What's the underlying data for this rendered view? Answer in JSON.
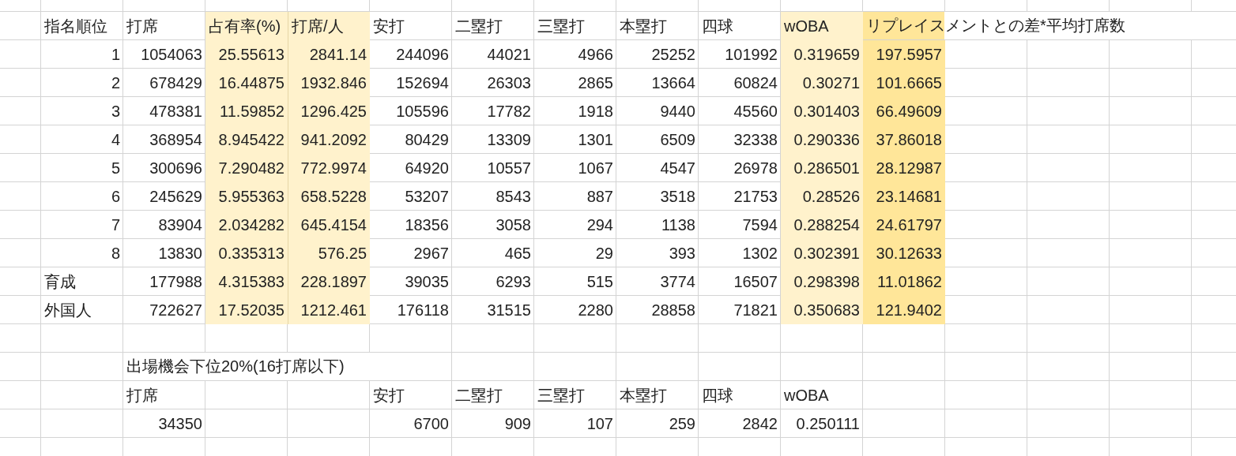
{
  "table": {
    "columns": [
      {
        "label": "指名順位"
      },
      {
        "label": "打席"
      },
      {
        "label": "占有率(%)",
        "color": "#fff2cc"
      },
      {
        "label": "打席/人",
        "color": "#fff2cc"
      },
      {
        "label": "安打"
      },
      {
        "label": "二塁打"
      },
      {
        "label": "三塁打"
      },
      {
        "label": "本塁打"
      },
      {
        "label": "四球"
      },
      {
        "label": "wOBA",
        "color": "#fff2cc"
      },
      {
        "label": "リプレイスメントとの差*平均打席数",
        "color": "#ffe699"
      }
    ],
    "rows": [
      {
        "kind": "rank",
        "cells": [
          "1",
          "1054063",
          "25.55613",
          "2841.14",
          "244096",
          "44021",
          "4966",
          "25252",
          "101992",
          "0.319659",
          "197.5957"
        ]
      },
      {
        "kind": "rank",
        "cells": [
          "2",
          "678429",
          "16.44875",
          "1932.846",
          "152694",
          "26303",
          "2865",
          "13664",
          "60824",
          "0.30271",
          "101.6665"
        ]
      },
      {
        "kind": "rank",
        "cells": [
          "3",
          "478381",
          "11.59852",
          "1296.425",
          "105596",
          "17782",
          "1918",
          "9440",
          "45560",
          "0.301403",
          "66.49609"
        ]
      },
      {
        "kind": "rank",
        "cells": [
          "4",
          "368954",
          "8.945422",
          "941.2092",
          "80429",
          "13309",
          "1301",
          "6509",
          "32338",
          "0.290336",
          "37.86018"
        ]
      },
      {
        "kind": "rank",
        "cells": [
          "5",
          "300696",
          "7.290482",
          "772.9974",
          "64920",
          "10557",
          "1067",
          "4547",
          "26978",
          "0.286501",
          "28.12987"
        ]
      },
      {
        "kind": "rank",
        "cells": [
          "6",
          "245629",
          "5.955363",
          "658.5228",
          "53207",
          "8543",
          "887",
          "3518",
          "21753",
          "0.28526",
          "23.14681"
        ]
      },
      {
        "kind": "rank",
        "cells": [
          "7",
          "83904",
          "2.034282",
          "645.4154",
          "18356",
          "3058",
          "294",
          "1138",
          "7594",
          "0.288254",
          "24.61797"
        ]
      },
      {
        "kind": "rank",
        "cells": [
          "8",
          "13830",
          "0.335313",
          "576.25",
          "2967",
          "465",
          "29",
          "393",
          "1302",
          "0.302391",
          "30.12633"
        ]
      },
      {
        "kind": "group",
        "cells": [
          "育成",
          "177988",
          "4.315383",
          "228.1897",
          "39035",
          "6293",
          "515",
          "3774",
          "16507",
          "0.298398",
          "11.01862"
        ]
      },
      {
        "kind": "group",
        "cells": [
          "外国人",
          "722627",
          "17.52035",
          "1212.461",
          "176118",
          "31515",
          "2280",
          "28858",
          "71821",
          "0.350683",
          "121.9402"
        ]
      }
    ]
  },
  "subtable": {
    "title": "出場機会下位20%(16打席以下)",
    "columns": [
      {
        "label": "打席",
        "value": "34350"
      },
      {
        "label": "安打",
        "value": "6700"
      },
      {
        "label": "二塁打",
        "value": "909"
      },
      {
        "label": "三塁打",
        "value": "107"
      },
      {
        "label": "本塁打",
        "value": "259"
      },
      {
        "label": "四球",
        "value": "2842"
      },
      {
        "label": "wOBA",
        "value": "0.250111"
      }
    ]
  }
}
